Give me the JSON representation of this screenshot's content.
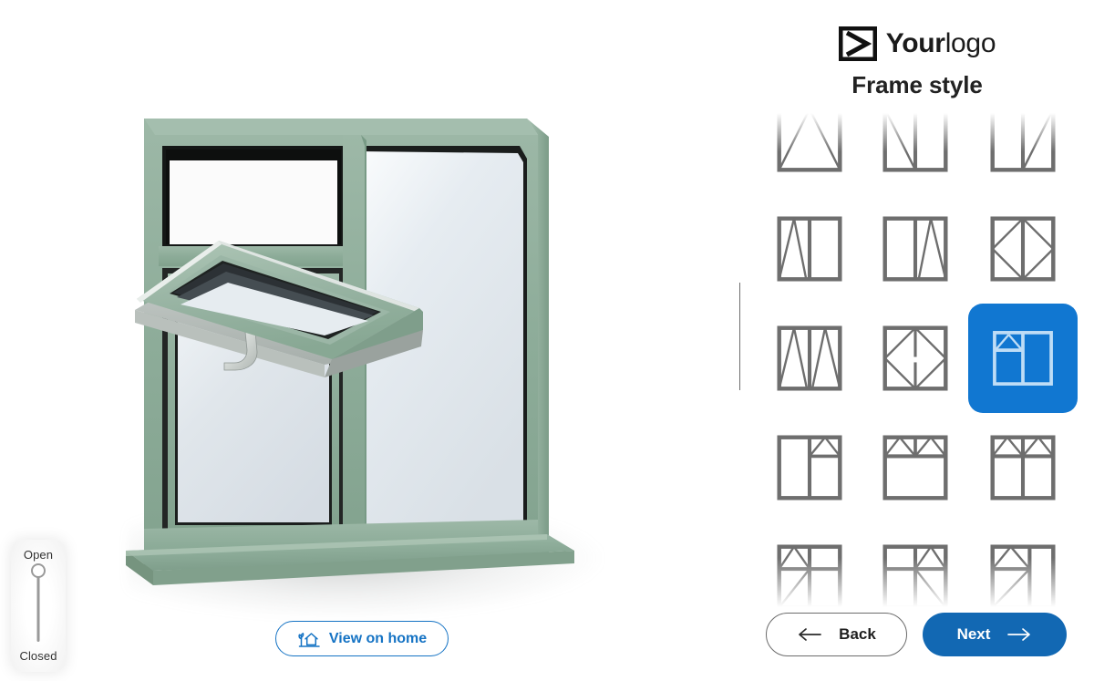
{
  "brand": {
    "logo_icon": "chevron-square-logo-icon",
    "name_bold": "Your",
    "name_light": "logo",
    "accent_blue": "#1177D1",
    "button_blue": "#1268B3",
    "frame_green": "#8FAE9B",
    "glass_color": "#DDE3E8",
    "icon_stroke": "#6E6E6E"
  },
  "panel": {
    "title": "Frame style"
  },
  "preview": {
    "product": "green-casement-window-with-open-top-vent",
    "slider": {
      "name": "open-closed-slider",
      "top_label": "Open",
      "bottom_label": "Closed",
      "value": "Open",
      "position_percent": 0
    },
    "view_on_home": {
      "label": "View on home",
      "icon": "house-with-plant-icon"
    }
  },
  "frame_styles": {
    "selected_index": 8,
    "columns": 3,
    "items": [
      {
        "id": "style-1",
        "name": "top-hung-triangle-full-width",
        "icon": "full-triangle"
      },
      {
        "id": "style-2",
        "name": "side-hung-left-diagonal-two-pane",
        "icon": "two-pane-left-diag"
      },
      {
        "id": "style-3",
        "name": "side-hung-right-diagonal-two-pane",
        "icon": "two-pane-right-diag"
      },
      {
        "id": "style-4",
        "name": "tilt-left-narrow-vent-two-pane",
        "icon": "two-pane-left-vee"
      },
      {
        "id": "style-5",
        "name": "tilt-right-narrow-vent-two-pane",
        "icon": "two-pane-right-vee"
      },
      {
        "id": "style-6",
        "name": "french-double-opener",
        "icon": "double-diamond"
      },
      {
        "id": "style-7",
        "name": "tilt-both-sides-two-pane",
        "icon": "two-pane-double-vee"
      },
      {
        "id": "style-8",
        "name": "tilt-and-turn-single-pane",
        "icon": "diamond-with-bar"
      },
      {
        "id": "style-9",
        "name": "top-vent-left-with-full-right-pane",
        "icon": "left-top-vent-right-full"
      },
      {
        "id": "style-10",
        "name": "left-full-pane-right-top-vent",
        "icon": "left-full-right-top-vent"
      },
      {
        "id": "style-11",
        "name": "two-top-vents-over-full-pane",
        "icon": "two-top-vents-one-bottom"
      },
      {
        "id": "style-12",
        "name": "two-top-vents-over-two-panes",
        "icon": "two-top-vents-two-bottom"
      },
      {
        "id": "style-13",
        "name": "top-vent-left-side-hung-left-bottom",
        "icon": "quad-vent-left-diag"
      },
      {
        "id": "style-14",
        "name": "top-vent-right-side-hung-right-bottom",
        "icon": "quad-vent-right-diag"
      },
      {
        "id": "style-15",
        "name": "top-vent-left-narrow-with-right-full",
        "icon": "narrow-left-vent-diag"
      }
    ]
  },
  "footer": {
    "back": {
      "label": "Back",
      "icon": "arrow-left-icon"
    },
    "next": {
      "label": "Next",
      "icon": "arrow-right-icon"
    }
  }
}
